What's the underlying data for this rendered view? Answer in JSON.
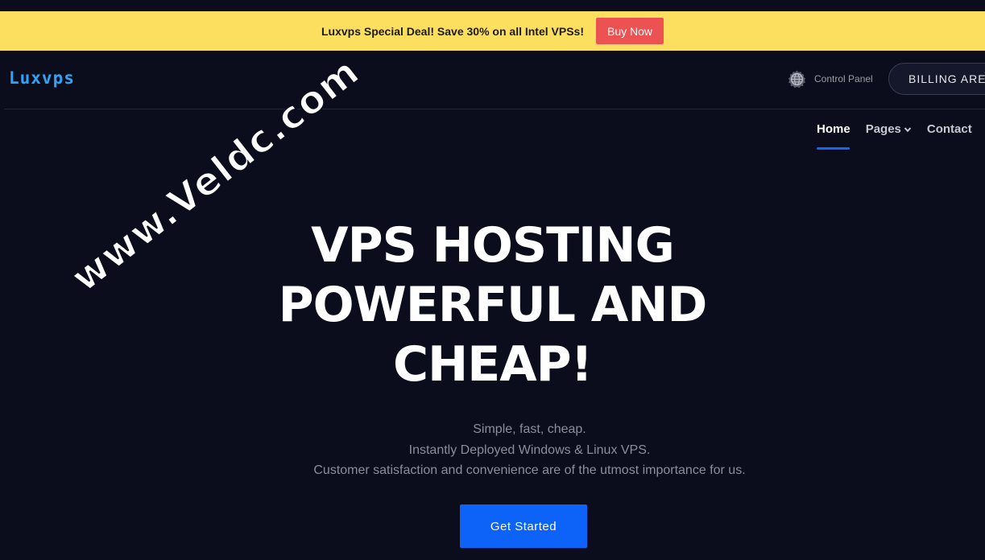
{
  "promo": {
    "text": "Luxvps Special Deal! Save 30% on all Intel VPSs!",
    "button_label": "Buy Now"
  },
  "header": {
    "logo": "Luxvps",
    "control_panel_label": "Control Panel",
    "control_panel_icon": "globe-icon",
    "billing_label": "BILLING AREA"
  },
  "nav": {
    "items": [
      {
        "label": "Home",
        "active": true
      },
      {
        "label": "Pages",
        "has_dropdown": true
      },
      {
        "label": "Contact"
      }
    ]
  },
  "watermark": "www.Veldc.com",
  "hero": {
    "title_lines": [
      "VPS HOSTING",
      "POWERFUL AND",
      "CHEAP!"
    ],
    "subtitle_lines": [
      "Simple, fast, cheap.",
      "Instantly Deployed Windows & Linux VPS.",
      "Customer satisfaction and convenience are of the utmost importance for us."
    ],
    "cta_label": "Get Started"
  },
  "colors": {
    "background": "#0b0d1c",
    "promo_bar": "#fddf60",
    "buy_now": "#ec5252",
    "logo": "#2fa3f5",
    "accent": "#0d63f8"
  }
}
